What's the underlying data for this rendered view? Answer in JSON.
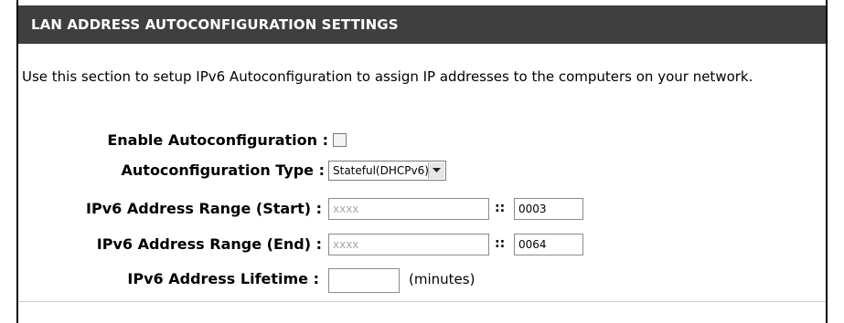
{
  "section": {
    "title": "LAN ADDRESS AUTOCONFIGURATION SETTINGS",
    "description": "Use this section to setup IPv6 Autoconfiguration to assign IP addresses to the computers on your network."
  },
  "form": {
    "enable_autoconfig": {
      "label": "Enable Autoconfiguration :",
      "checked": false
    },
    "autoconfig_type": {
      "label": "Autoconfiguration Type :",
      "selected": "Stateful(DHCPv6)"
    },
    "range_start": {
      "label": "IPv6 Address Range (Start) :",
      "prefix_placeholder": "xxxx",
      "separator": "::",
      "suffix_value": "0003"
    },
    "range_end": {
      "label": "IPv6 Address Range (End) :",
      "prefix_placeholder": "xxxx",
      "separator": "::",
      "suffix_value": "0064"
    },
    "lifetime": {
      "label": "IPv6 Address Lifetime :",
      "value": "",
      "unit": "(minutes)"
    }
  },
  "colors": {
    "header_bg": "#3f3f3f",
    "header_text": "#ffffff"
  }
}
